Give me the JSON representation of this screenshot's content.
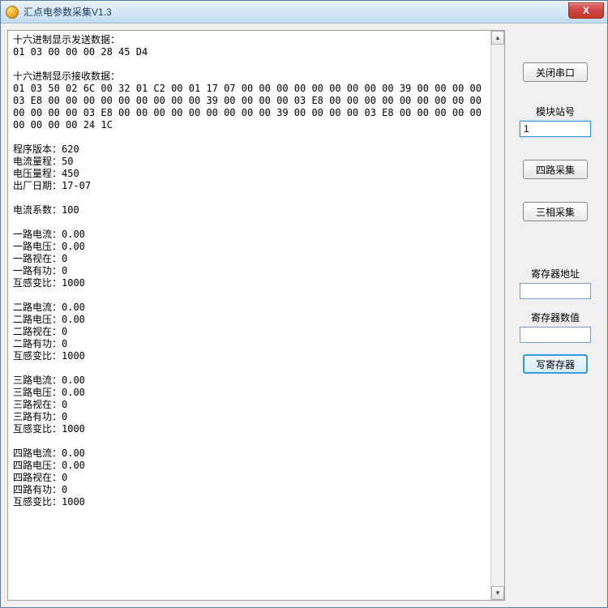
{
  "window": {
    "title": "汇点电参数采集V1.3"
  },
  "log": {
    "sendHeader": "十六进制显示发送数据：",
    "sendData": "01 03 00 00 00 28 45 D4",
    "recvHeader": "十六进制显示接收数据：",
    "recvData": "01 03 50 02 6C 00 32 01 C2 00 01 17 07 00 00 00 00 00 00 00 00 00 39 00 00 00 00 03 E8 00 00 00 00 00 00 00 00 00 39 00 00 00 00 03 E8 00 00 00 00 00 00 00 00 00 00 00 00 00 03 E8 00 00 00 00 00 00 00 00 00 39 00 00 00 00 03 E8 00 00 00 00 00 00 00 00 00 24 1C",
    "info": {
      "version": "程序版本：620",
      "currentRange": "电流量程：50",
      "voltageRange": "电压量程：450",
      "factoryDate": "出厂日期：17-07",
      "currentCoef": "电流系数：100"
    },
    "ch1": {
      "current": "一路电流：0.00",
      "voltage": "一路电压：0.00",
      "apparent": "一路视在：0",
      "active": "一路有功：0",
      "ratio": "互感变比：1000"
    },
    "ch2": {
      "current": "二路电流：0.00",
      "voltage": "二路电压：0.00",
      "apparent": "二路视在：0",
      "active": "二路有功：0",
      "ratio": "互感变比：1000"
    },
    "ch3": {
      "current": "三路电流：0.00",
      "voltage": "三路电压：0.00",
      "apparent": "三路视在：0",
      "active": "三路有功：0",
      "ratio": "互感变比：1000"
    },
    "ch4": {
      "current": "四路电流：0.00",
      "voltage": "四路电压：0.00",
      "apparent": "四路视在：0",
      "active": "四路有功：0",
      "ratio": "互感变比：1000"
    }
  },
  "sidebar": {
    "closePort": "关闭串口",
    "stationLabel": "模块站号",
    "stationValue": "1",
    "fourCh": "四路采集",
    "threePhase": "三相采集",
    "regAddrLabel": "寄存器地址",
    "regAddrValue": "",
    "regValLabel": "寄存器数值",
    "regValValue": "",
    "writeReg": "写寄存器"
  }
}
